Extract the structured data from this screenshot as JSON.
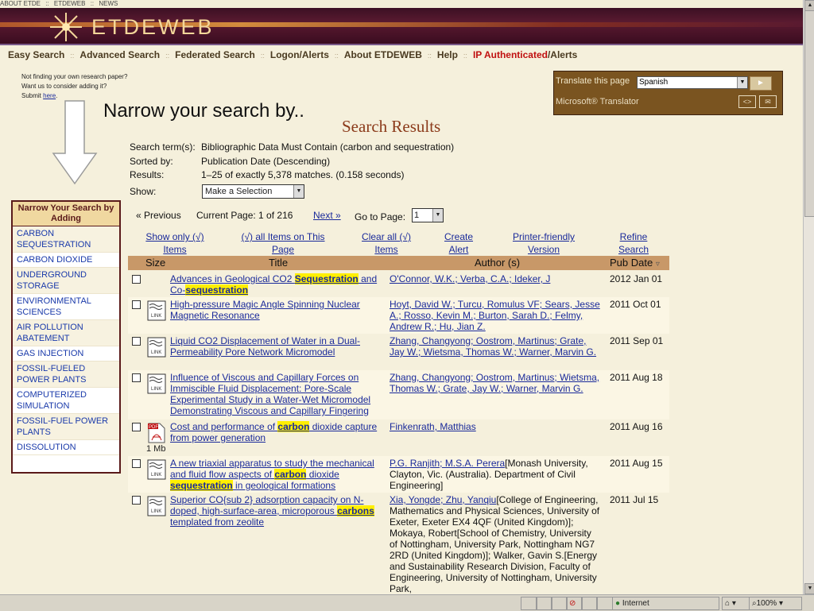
{
  "topbar": {
    "links": [
      "ABOUT ETDE",
      "::",
      "ETDEWEB",
      "::",
      "NEWS"
    ]
  },
  "brand": {
    "name": "ETDEWEB"
  },
  "nav": {
    "items": [
      {
        "label": "Easy Search"
      },
      {
        "label": "Advanced Search"
      },
      {
        "label": "Federated Search"
      },
      {
        "label": "Logon/Alerts"
      },
      {
        "label": "About ETDEWEB"
      },
      {
        "label": "Help"
      }
    ],
    "ip_label": "IP Authenticated",
    "alerts_label": "/Alerts",
    "separator": "::"
  },
  "side_note": {
    "line1": "Not finding your own research paper?",
    "line2": "Want us to consider adding it?",
    "line3_prefix": "Submit ",
    "link": "here",
    "suffix": "."
  },
  "narrow_heading": "Narrow your search by..",
  "translator": {
    "label": "Translate this page",
    "language": "Spanish",
    "brand": "Microsoft® Translator",
    "go": "►"
  },
  "results": {
    "title": "Search Results",
    "search_term_label": "Search term(s):",
    "search_term": "Bibliographic Data Must Contain (carbon and sequestration)",
    "sorted_label": "Sorted by:",
    "sorted": "Publication Date (Descending)",
    "results_label": "Results:",
    "results": "1–25 of exactly 5,378 matches. (0.158 seconds)",
    "show_label": "Show:",
    "show_value": "Make a Selection",
    "previous": "« Previous",
    "current_page": "Current Page: 1 of 216",
    "next": "Next »",
    "goto_label": "Go to Page:",
    "goto_value": "1"
  },
  "actions": {
    "show_only": "Show only (√) Items",
    "all_items": "(√) all Items on This Page",
    "clear_all": "Clear all (√) Items",
    "create_alert": "Create Alert",
    "printer": "Printer-friendly Version",
    "refine": "Refine Search"
  },
  "columns": {
    "size": "Size",
    "title": "Title",
    "author": "Author (s)",
    "date": "Pub Date",
    "sort_icon": "▿"
  },
  "narrow_box": {
    "header": "Narrow Your Search by Adding",
    "items": [
      "CARBON SEQUESTRATION",
      "CARBON DIOXIDE",
      "UNDERGROUND STORAGE",
      "ENVIRONMENTAL SCIENCES",
      "AIR POLLUTION ABATEMENT",
      "GAS INJECTION",
      "FOSSIL-FUELED POWER PLANTS",
      "COMPUTERIZED SIMULATION",
      "FOSSIL-FUEL POWER PLANTS",
      "DISSOLUTION"
    ]
  },
  "rows": [
    {
      "t1": "Advances in Geological CO2 ",
      "t1h": "Sequestration",
      "t2": " and Co-",
      "t2h": "sequestration",
      "authors": "O'Connor, W.K.; Verba, C.A.; Ideker, J",
      "date": "2012 Jan 01"
    },
    {
      "t1": "High-pressure Magic Angle Spinning Nuclear Magnetic Resonance",
      "authors": "Hoyt, David W.; Turcu, Romulus VF; Sears, Jesse A.; Rosso, Kevin M.; Burton, Sarah D.; Felmy, Andrew R.; Hu, Jian Z.",
      "date": "2011 Oct 01"
    },
    {
      "t1": "Liquid CO2 Displacement of Water in a Dual-Permeability Pore Network Micromodel",
      "authors": "Zhang, Changyong; Oostrom, Martinus; Grate, Jay W.; Wietsma, Thomas W.; Warner, Marvin G.",
      "date": "2011 Sep 01"
    },
    {
      "t1": "Influence of Viscous and Capillary Forces on Immiscible Fluid Displacement: Pore-Scale Experimental Study in a Water-Wet Micromodel Demonstrating Viscous and Capillary Fingering",
      "authors": "Zhang, Changyong; Oostrom, Martinus; Wietsma, Thomas W.; Grate, Jay W.; Warner, Marvin G.",
      "date": "2011 Aug 18"
    },
    {
      "t1": "Cost and performance of ",
      "t1h": "carbon",
      "t2": " dioxide capture from power generation",
      "authors": "Finkenrath, Matthias",
      "date": "2011 Aug 16",
      "size": "1 Mb"
    },
    {
      "t1": "A new triaxial apparatus to study the mechanical and fluid flow aspects of ",
      "t1h": "carbon",
      "t2": " dioxide ",
      "t2h": "sequestration",
      "t3": " in geological formations",
      "author_links": "P.G. Ranjith; M.S.A. Perera",
      "author_text": "[Monash University, Clayton, Vic. (Australia). Department of Civil Engineering]",
      "date": "2011 Aug 15"
    },
    {
      "t1": "Superior CO{sub 2} adsorption capacity on N-doped, high-surface-area, microporous ",
      "t1h": "carbons",
      "t2": " templated from zeolite",
      "author_links": "Xia, Yongde; Zhu, Yanqiu",
      "author_text": "[College of Engineering, Mathematics and Physical Sciences, University of Exeter, Exeter EX4 4QF (United Kingdom)]; Mokaya, Robert[School of Chemistry, University of Nottingham, University Park, Nottingham NG7 2RD (United Kingdom)]; Walker, Gavin S.[Energy and Sustainability Research Division, Faculty of Engineering, University of Nottingham, University Park,",
      "date": "2011 Jul 15"
    }
  ],
  "status": {
    "zone": "Internet",
    "zoom": "100%"
  }
}
